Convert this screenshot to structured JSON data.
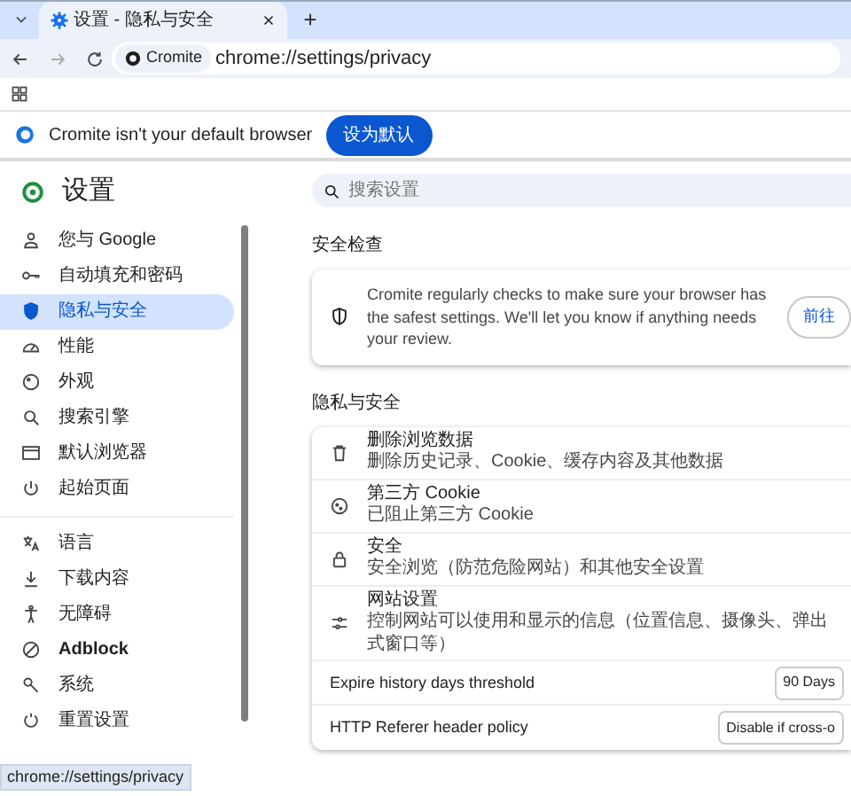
{
  "tab": {
    "title": "设置 - 隐私与安全",
    "selected": true
  },
  "toolbar": {
    "site_chip": "Cromite",
    "url": "chrome://settings/privacy"
  },
  "infobar": {
    "message": "Cromite isn't your default browser",
    "button": "设为默认"
  },
  "settings": {
    "title": "设置",
    "search": {
      "placeholder": "搜索设置"
    },
    "sidebar": {
      "groups": [
        [
          {
            "label": "您与 Google",
            "selected": false
          },
          {
            "label": "自动填充和密码",
            "selected": false
          },
          {
            "label": "隐私与安全",
            "selected": true
          },
          {
            "label": "性能",
            "selected": false
          },
          {
            "label": "外观",
            "selected": false
          },
          {
            "label": "搜索引擎",
            "selected": false
          },
          {
            "label": "默认浏览器",
            "selected": false
          },
          {
            "label": "起始页面",
            "selected": false
          }
        ],
        [
          {
            "label": "语言",
            "selected": false
          },
          {
            "label": "下载内容",
            "selected": false
          },
          {
            "label": "无障碍",
            "selected": false
          },
          {
            "label": "Adblock",
            "selected": false
          },
          {
            "label": "系统",
            "selected": false
          },
          {
            "label": "重置设置",
            "selected": false
          }
        ]
      ]
    },
    "safety_check": {
      "heading": "安全检查",
      "text": "Cromite regularly checks to make sure your browser has the safest settings. We'll let you know if anything needs your review.",
      "button": "前往"
    },
    "privacy": {
      "heading": "隐私与安全",
      "items": [
        {
          "kind": "link",
          "title": "删除浏览数据",
          "subtitle": "删除历史记录、Cookie、缓存内容及其他数据"
        },
        {
          "kind": "link",
          "title": "第三方 Cookie",
          "subtitle": "已阻止第三方 Cookie"
        },
        {
          "kind": "link",
          "title": "安全",
          "subtitle": "安全浏览（防范危险网站）和其他安全设置"
        },
        {
          "kind": "link",
          "title": "网站设置",
          "subtitle": "控制网站可以使用和显示的信息（位置信息、摄像头、弹出式窗口等）"
        },
        {
          "kind": "select",
          "title": "Expire history days threshold",
          "value": "90 Days"
        },
        {
          "kind": "select",
          "title": "HTTP Referer header policy",
          "value": "Disable if cross-o"
        }
      ]
    }
  },
  "status_bar": "chrome://settings/privacy"
}
